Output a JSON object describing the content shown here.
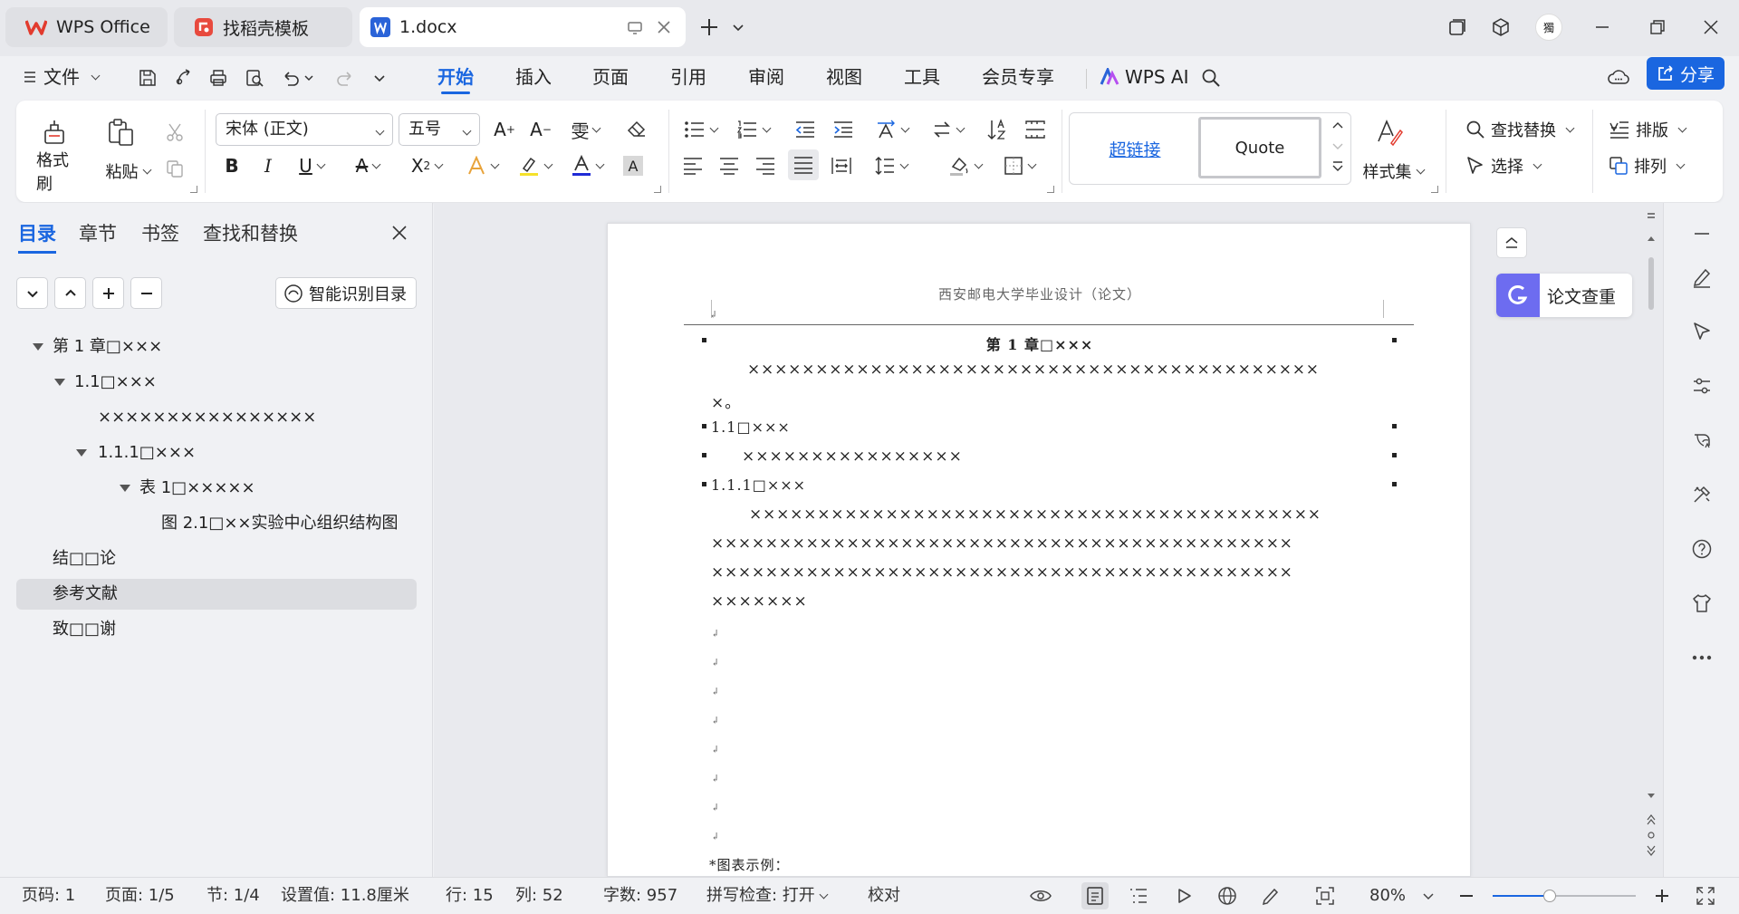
{
  "titlebar": {
    "tabs": [
      {
        "label": "WPS Office"
      },
      {
        "label": "找稻壳模板"
      },
      {
        "label": "1.docx"
      }
    ],
    "avatar_text": "獨"
  },
  "menubar": {
    "file_label": "文件",
    "tabs": [
      "开始",
      "插入",
      "页面",
      "引用",
      "审阅",
      "视图",
      "工具",
      "会员专享"
    ],
    "active_tab": "开始",
    "wps_ai_label": "WPS AI",
    "share_label": "分享"
  },
  "ribbon": {
    "format_painter": "格式刷",
    "paste": "粘贴",
    "font_name": "宋体 (正文)",
    "font_size": "五号",
    "style_link": "超链接",
    "style_quote": "Quote",
    "style_set": "样式集",
    "find_replace": "查找替换",
    "select": "选择",
    "layout": "排版",
    "arrange": "排列"
  },
  "nav_panel": {
    "tabs": [
      "目录",
      "章节",
      "书签",
      "查找和替换"
    ],
    "auto_toc_label": "智能识别目录",
    "toc": [
      {
        "text": "第 1 章□×××",
        "level": 1,
        "expand": true
      },
      {
        "text": "1.1□×××",
        "level": 2,
        "expand": true
      },
      {
        "text": "××××××××××××××××",
        "level": 3,
        "expand": false
      },
      {
        "text": "1.1.1□×××",
        "level": 3,
        "expand": true
      },
      {
        "text": "表 1□×××××",
        "level": 4,
        "expand": true
      },
      {
        "text": "图 2.1□××实验中心组织结构图",
        "level": 5,
        "expand": false
      },
      {
        "text": "结□□论",
        "level": 1,
        "expand": false
      },
      {
        "text": "参考文献",
        "level": 1,
        "expand": false,
        "selected": true
      },
      {
        "text": "致□□谢",
        "level": 1,
        "expand": false
      }
    ]
  },
  "document": {
    "header": "西安邮电大学毕业设计（论文）",
    "chapter_title": "第 1 章□×××",
    "para1_line1": "××××××××××××××××××××××××××××××××××××××××××",
    "para1_line2": "×。",
    "h2": "1.1□×××",
    "line_x16": "××××××××××××××××",
    "h3": "1.1.1□×××",
    "para2_line1": "××××××××××××××××××××××××××××××××××××××××××",
    "para2_line2": "×××××××××××××××××××××××××××××××××××××××××××",
    "para2_line3": "×××××××××××××××××××××××××××××××××××××××××××",
    "para2_line4": "×××××××",
    "figure_caption": "*图表示例："
  },
  "check_card_label": "论文查重",
  "statusbar": {
    "page_code": "页码: 1",
    "page": "页面: 1/5",
    "section": "节: 1/4",
    "setting": "设置值: 11.8厘米",
    "row": "行: 15",
    "col": "列: 52",
    "word_count": "字数: 957",
    "spellcheck": "拼写检查: 打开",
    "proofread": "校对",
    "zoom": "80%",
    "zoom_level": 0.4
  },
  "colors": {
    "accent": "#1a66e0",
    "wps_red": "#e23b2e",
    "word_blue": "#2a63d8",
    "check_purple": "#6d6cf0"
  }
}
